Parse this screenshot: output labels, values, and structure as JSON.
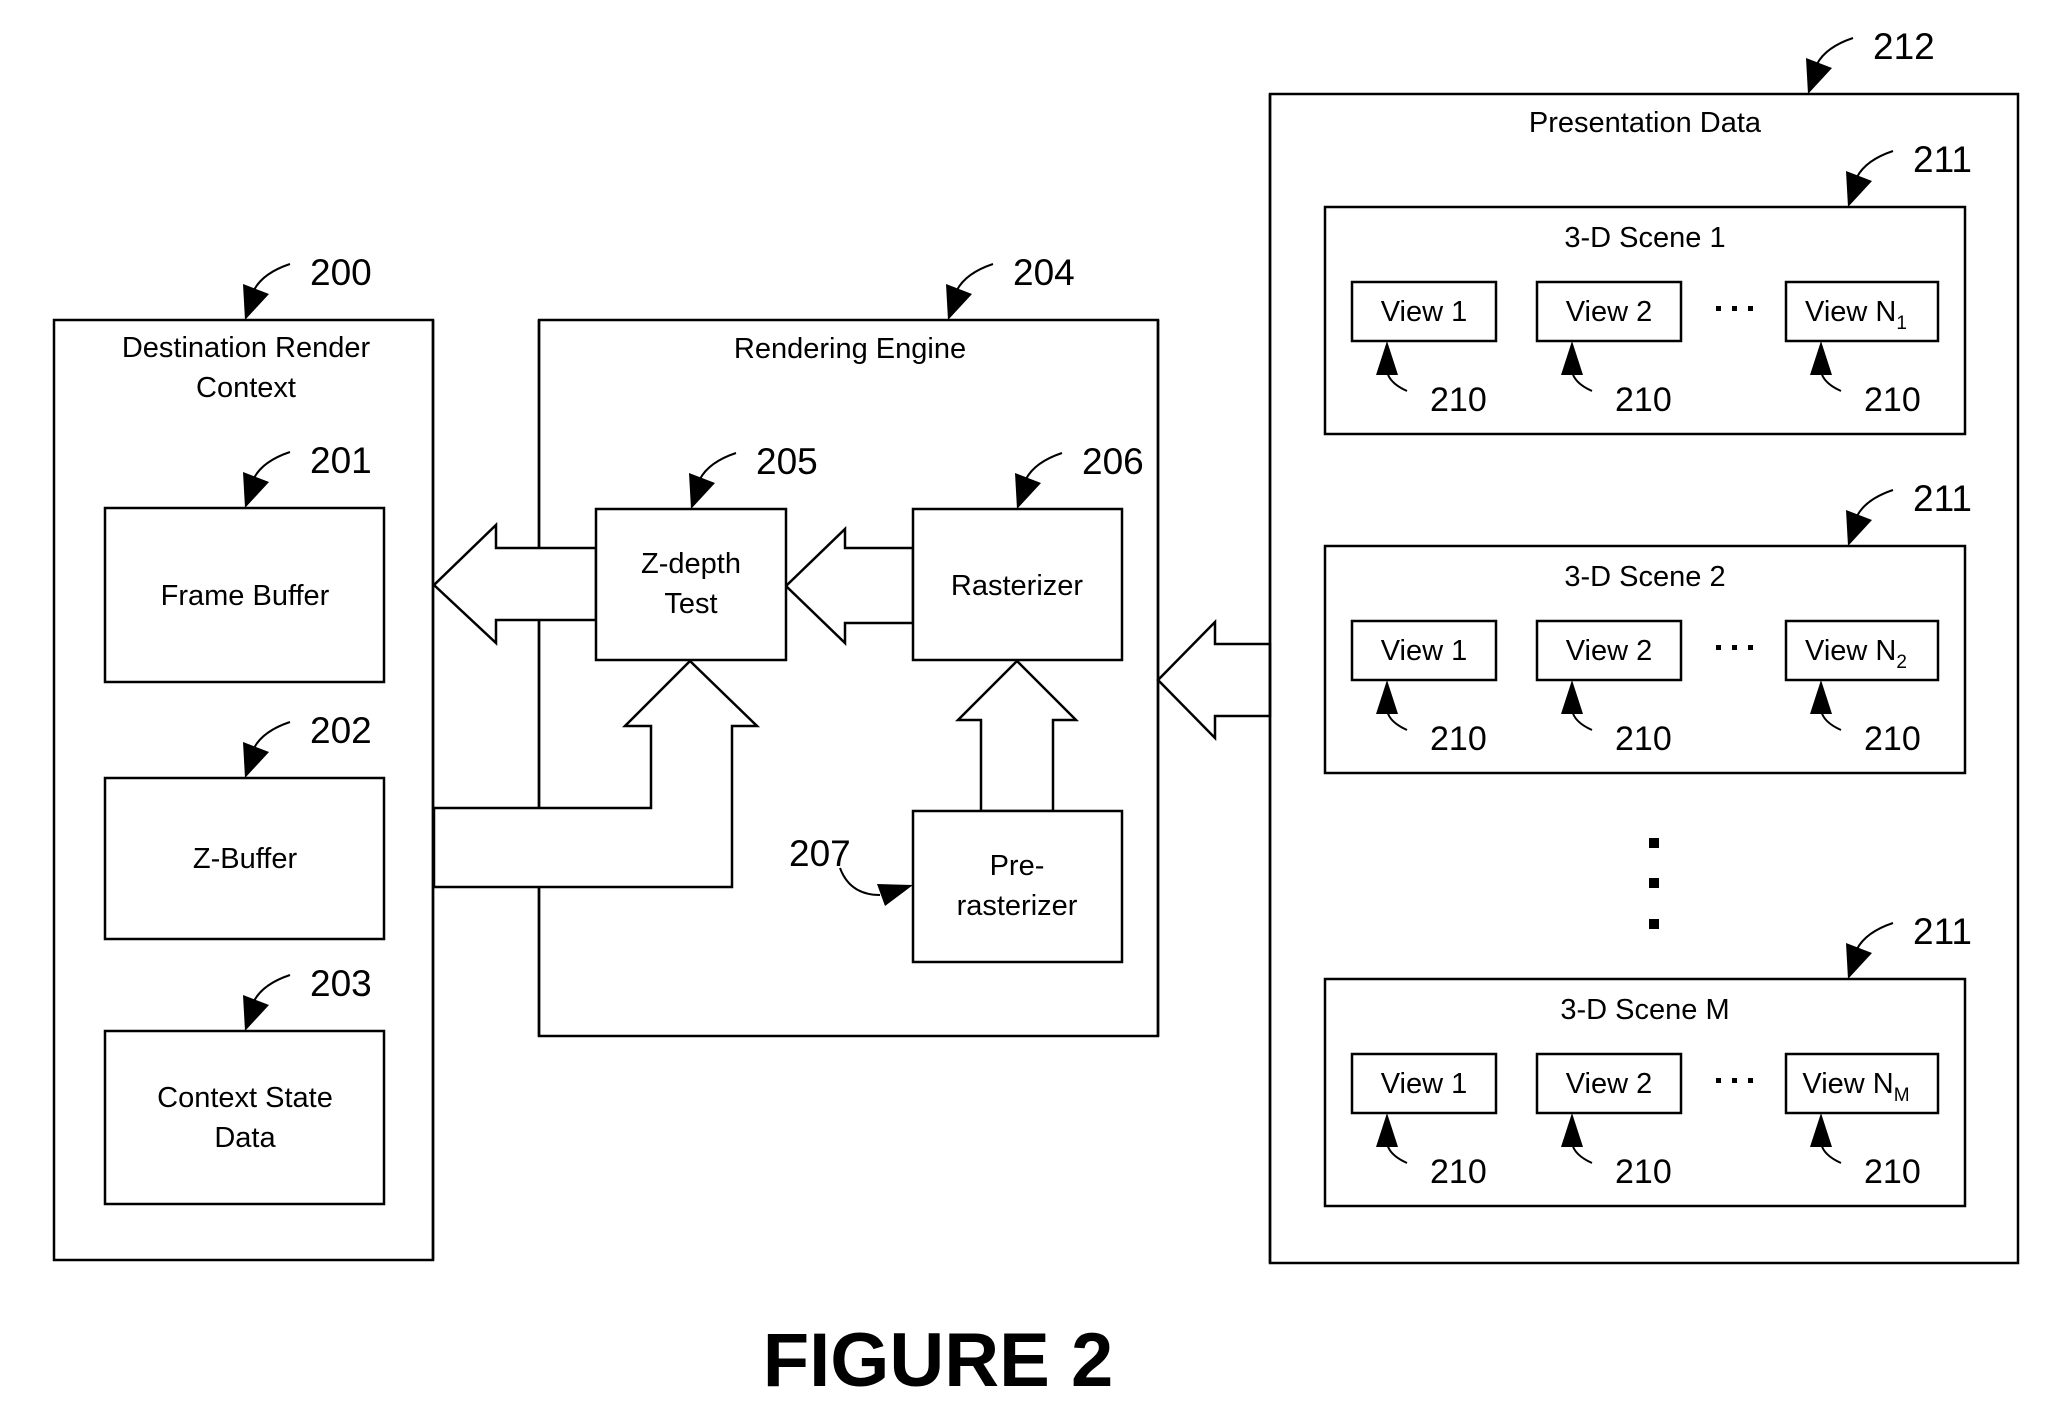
{
  "figure": {
    "caption": "FIGURE 2",
    "destination_render_context": {
      "ref": "200",
      "title_line1": "Destination Render",
      "title_line2": "Context",
      "frame_buffer": {
        "ref": "201",
        "label": "Frame Buffer"
      },
      "z_buffer": {
        "ref": "202",
        "label": "Z-Buffer"
      },
      "context_state": {
        "ref": "203",
        "label_line1": "Context State",
        "label_line2": "Data"
      }
    },
    "rendering_engine": {
      "ref": "204",
      "title": "Rendering Engine",
      "z_depth": {
        "ref": "205",
        "label_line1": "Z-depth",
        "label_line2": "Test"
      },
      "rasterizer": {
        "ref": "206",
        "label": "Rasterizer"
      },
      "pre_rasterizer": {
        "ref": "207",
        "label_line1": "Pre-",
        "label_line2": "rasterizer"
      }
    },
    "presentation_data": {
      "ref": "212",
      "title": "Presentation Data",
      "ellipsis": "…",
      "scenes": [
        {
          "ref": "211",
          "title": "3-D Scene 1",
          "views": [
            {
              "label": "View 1",
              "sub": "",
              "ref": "210"
            },
            {
              "label": "View  2",
              "sub": "",
              "ref": "210"
            },
            {
              "label": "View N",
              "sub": "1",
              "ref": "210"
            }
          ]
        },
        {
          "ref": "211",
          "title": "3-D Scene 2",
          "views": [
            {
              "label": "View 1",
              "sub": "",
              "ref": "210"
            },
            {
              "label": "View  2",
              "sub": "",
              "ref": "210"
            },
            {
              "label": "View N",
              "sub": "2",
              "ref": "210"
            }
          ]
        },
        {
          "ref": "211",
          "title": "3-D Scene M",
          "views": [
            {
              "label": "View 1",
              "sub": "",
              "ref": "210"
            },
            {
              "label": "View  2",
              "sub": "",
              "ref": "210"
            },
            {
              "label": "View N",
              "sub": "M",
              "ref": "210"
            }
          ]
        }
      ]
    }
  }
}
